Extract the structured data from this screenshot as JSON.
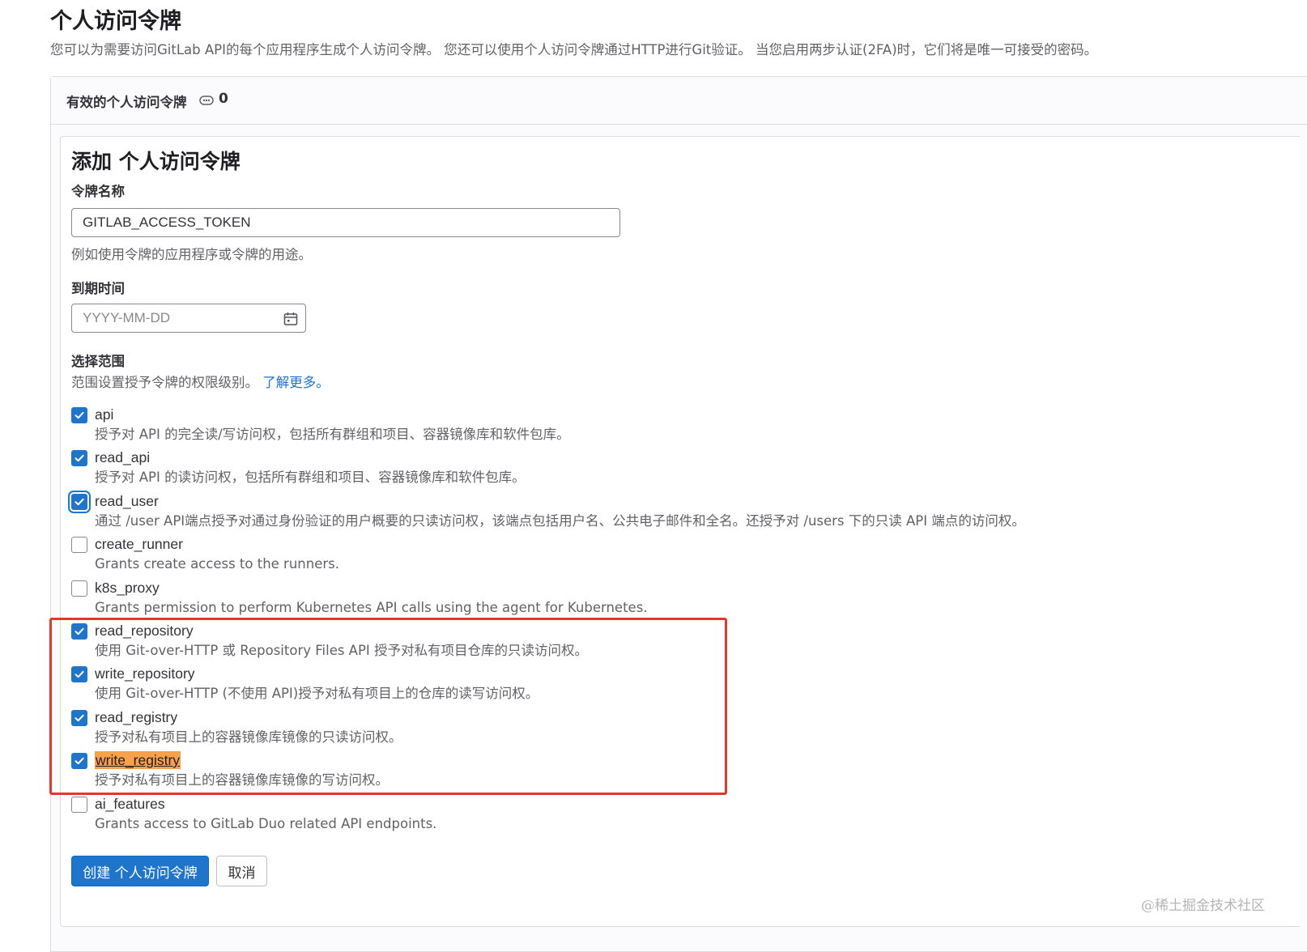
{
  "header": {
    "title": "个人访问令牌",
    "description": "您可以为需要访问GitLab API的每个应用程序生成个人访问令牌。 您还可以使用个人访问令牌通过HTTP进行Git验证。 当您启用两步认证(2FA)时，它们将是唯一可接受的密码。"
  },
  "active_tokens": {
    "title": "有效的个人访问令牌",
    "count": "0",
    "icon": "token-icon"
  },
  "form": {
    "title": "添加 个人访问令牌",
    "name_label": "令牌名称",
    "name_value": "GITLAB_ACCESS_TOKEN",
    "name_help": "例如使用令牌的应用程序或令牌的用途。",
    "expiry_label": "到期时间",
    "expiry_placeholder": "YYYY-MM-DD",
    "scopes_label": "选择范围",
    "scopes_help": "范围设置授予令牌的权限级别。",
    "learn_more": "了解更多。",
    "scopes": [
      {
        "name": "api",
        "description": "授予对 API 的完全读/写访问权，包括所有群组和项目、容器镜像库和软件包库。",
        "checked": true
      },
      {
        "name": "read_api",
        "description": "授予对 API 的读访问权，包括所有群组和项目、容器镜像库和软件包库。",
        "checked": true
      },
      {
        "name": "read_user",
        "description": "通过 /user API端点授予对通过身份验证的用户概要的只读访问权，该端点包括用户名、公共电子邮件和全名。还授予对 /users 下的只读 API 端点的访问权。",
        "checked": true,
        "focused": true
      },
      {
        "name": "create_runner",
        "description": "Grants create access to the runners.",
        "checked": false
      },
      {
        "name": "k8s_proxy",
        "description": "Grants permission to perform Kubernetes API calls using the agent for Kubernetes.",
        "checked": false
      },
      {
        "name": "read_repository",
        "description": "使用 Git-over-HTTP 或 Repository Files API 授予对私有项目仓库的只读访问权。",
        "checked": true
      },
      {
        "name": "write_repository",
        "description": "使用 Git-over-HTTP (不使用 API)授予对私有项目上的仓库的读写访问权。",
        "checked": true
      },
      {
        "name": "read_registry",
        "description": "授予对私有项目上的容器镜像库镜像的只读访问权。",
        "checked": true
      },
      {
        "name": "write_registry",
        "description": "授予对私有项目上的容器镜像库镜像的写访问权。",
        "checked": true,
        "highlighted": true
      },
      {
        "name": "ai_features",
        "description": "Grants access to GitLab Duo related API endpoints.",
        "checked": false
      }
    ],
    "create_button": "创建 个人访问令牌",
    "cancel_button": "取消"
  },
  "annotation_color": "#e8362d",
  "accent_color": "#1f75cb",
  "watermark": "@稀土掘金技术社区"
}
